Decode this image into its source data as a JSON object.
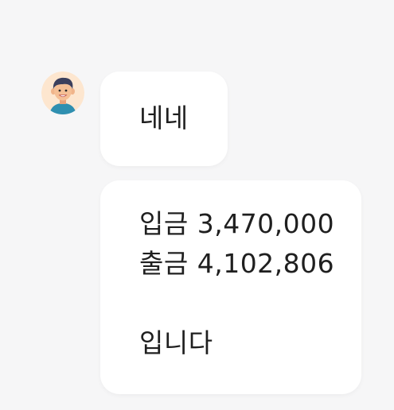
{
  "sender": {
    "avatar_icon": "boy-avatar-icon",
    "avatar_bg": "#fde6cf"
  },
  "messages": [
    {
      "lines": [
        "네네"
      ]
    },
    {
      "lines": [
        "입금 3,470,000",
        "출금 4,102,806",
        "",
        "입니다"
      ]
    }
  ],
  "colors": {
    "background": "#f6f6f7",
    "bubble": "#ffffff",
    "text": "#1f1f1f"
  }
}
